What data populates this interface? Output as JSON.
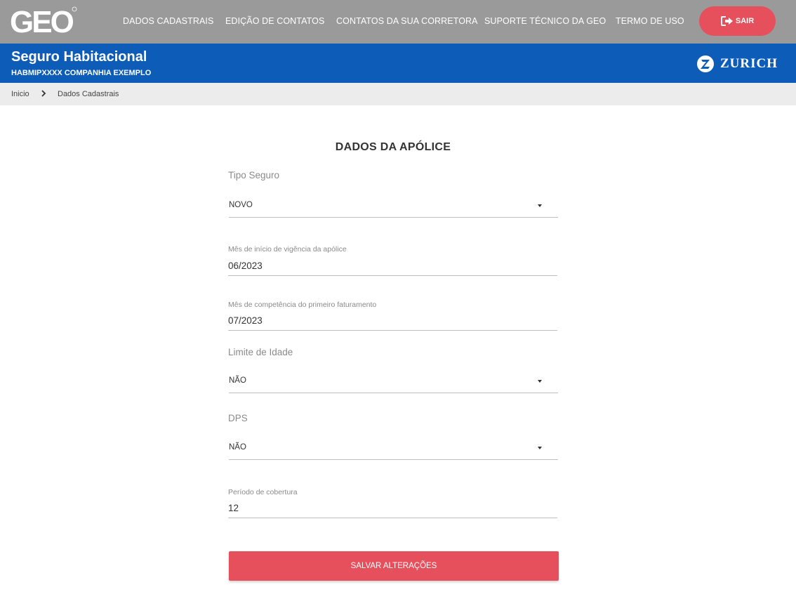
{
  "header": {
    "logo_text": "GEO",
    "nav": [
      {
        "label": "DADOS CADASTRAIS"
      },
      {
        "label": "EDIÇÃO DE CONTATOS"
      },
      {
        "label": "CONTATOS DA SUA CORRETORA"
      },
      {
        "label": "SUPORTE TÉCNICO DA GEO"
      },
      {
        "label": "TERMO DE USO"
      }
    ],
    "logout_label": "SAIR",
    "logout_icon": "sign-out-icon"
  },
  "product_bar": {
    "title": "Seguro Habitacional",
    "code": "HABMIPXXXX",
    "company": "COMPANHIA EXEMPLO",
    "brand": "ZURICH"
  },
  "breadcrumb": {
    "home": "Inicio",
    "current": "Dados Cadastrais"
  },
  "form": {
    "title": "DADOS DA APÓLICE",
    "tipo_seguro": {
      "label": "Tipo Seguro",
      "value": "NOVO"
    },
    "inicio_vigencia": {
      "label": "Mês de início de vigência da apólice",
      "value": "06/2023"
    },
    "competencia": {
      "label": "Mês de competência do primeiro faturamento",
      "value": "07/2023"
    },
    "limite_idade": {
      "label": "Limite de Idade",
      "value": "NÃO"
    },
    "dps": {
      "label": "DPS",
      "value": "NÃO"
    },
    "periodo_cobertura": {
      "label": "Período de cobertura",
      "value": "12"
    },
    "save_label": "SALVAR ALTERAÇÕES"
  },
  "colors": {
    "topbar": "#9a9a9a",
    "bluebar": "#0d5db8",
    "accent": "#e5505c",
    "breadcrumb_bg": "#ececec"
  }
}
